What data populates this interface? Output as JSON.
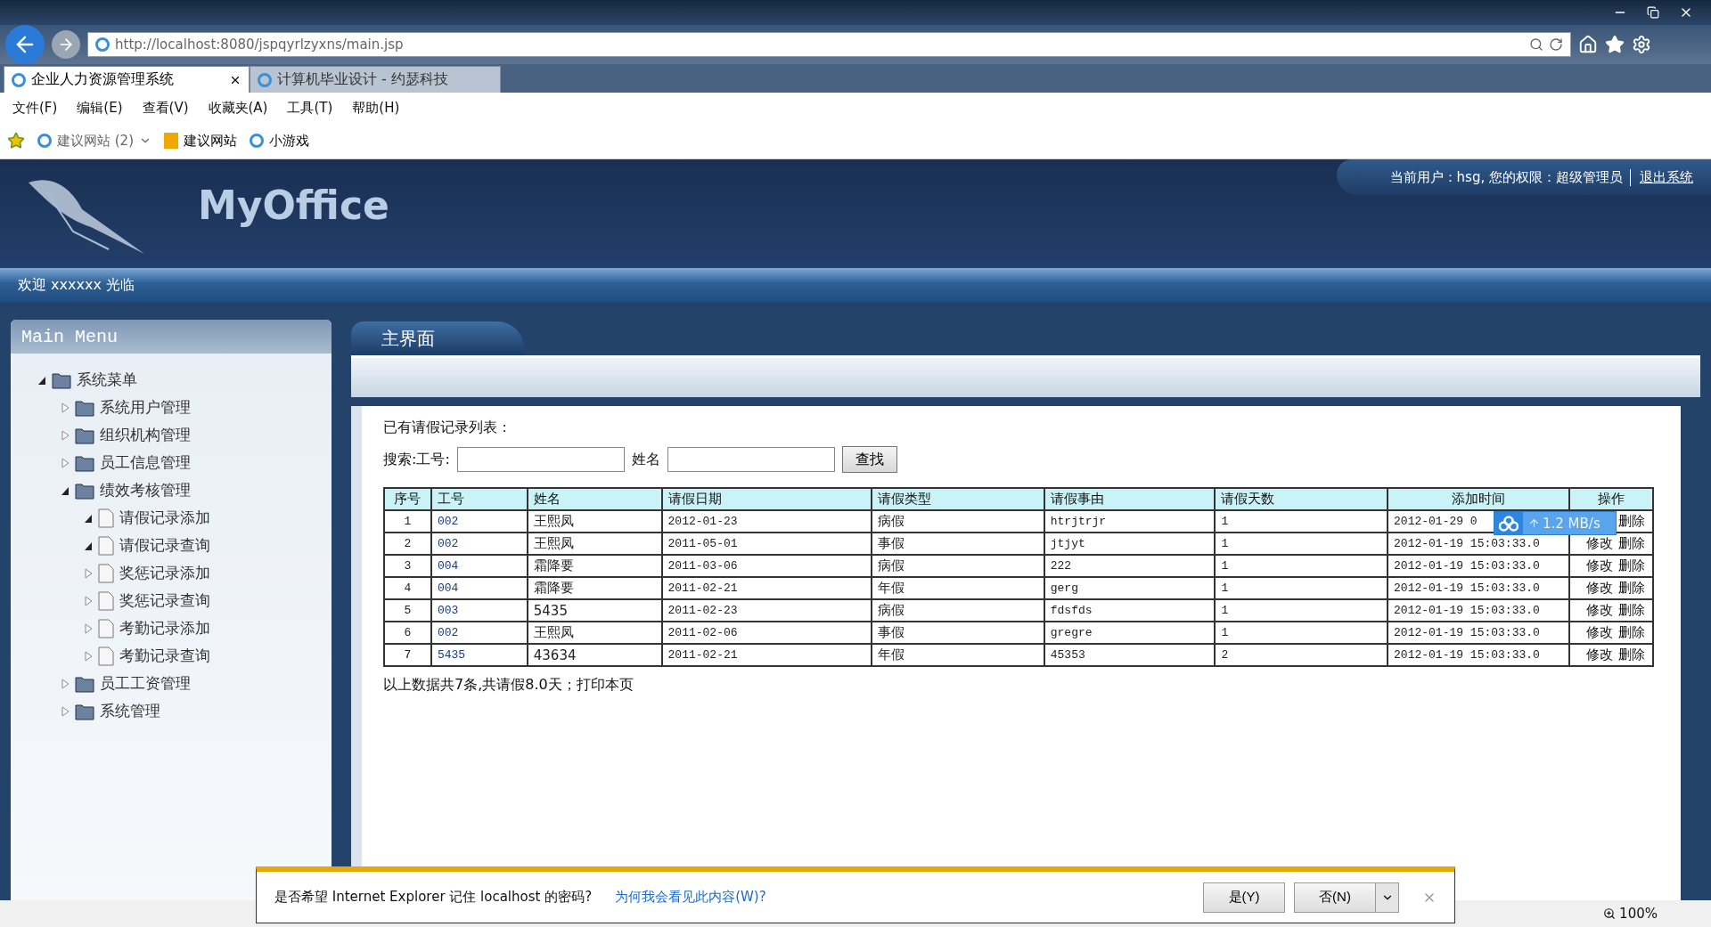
{
  "browser": {
    "address": "http://localhost:8080/jspqyrlzyxns/main.jsp",
    "tabs": [
      {
        "label": "企业人力资源管理系统",
        "selected": true
      },
      {
        "label": "计算机毕业设计 - 约瑟科技",
        "selected": false
      }
    ],
    "menu": [
      "文件(F)",
      "编辑(E)",
      "查看(V)",
      "收藏夹(A)",
      "工具(T)",
      "帮助(H)"
    ],
    "favorites": [
      {
        "label": "建议网站 (2)",
        "kind": "dropdown"
      },
      {
        "label": "建议网站",
        "kind": "bing"
      },
      {
        "label": "小游戏",
        "kind": "page"
      }
    ]
  },
  "header": {
    "logo": "MyOffice",
    "user_info": "当前用户：hsg, 您的权限：超级管理员",
    "logout": "退出系统"
  },
  "welcome": "欢迎 xxxxxx 光临",
  "sidebar": {
    "title": "Main Menu",
    "tree": [
      {
        "label": "系统菜单",
        "kind": "folder",
        "expanded": true,
        "children": [
          {
            "label": "系统用户管理",
            "kind": "folder",
            "expanded": false
          },
          {
            "label": "组织机构管理",
            "kind": "folder",
            "expanded": false
          },
          {
            "label": "员工信息管理",
            "kind": "folder",
            "expanded": false
          },
          {
            "label": "绩效考核管理",
            "kind": "folder",
            "expanded": true,
            "children": [
              {
                "label": "请假记录添加",
                "kind": "page",
                "expanded": true
              },
              {
                "label": "请假记录查询",
                "kind": "page",
                "expanded": true
              },
              {
                "label": "奖惩记录添加",
                "kind": "page",
                "expanded": false
              },
              {
                "label": "奖惩记录查询",
                "kind": "page",
                "expanded": false
              },
              {
                "label": "考勤记录添加",
                "kind": "page",
                "expanded": false
              },
              {
                "label": "考勤记录查询",
                "kind": "page",
                "expanded": false
              }
            ]
          },
          {
            "label": "员工工资管理",
            "kind": "folder",
            "expanded": false
          },
          {
            "label": "系统管理",
            "kind": "folder",
            "expanded": false
          }
        ]
      }
    ]
  },
  "main": {
    "tab": "主界面",
    "list_title": "已有请假记录列表：",
    "search": {
      "id_label": "搜索:工号:",
      "name_label": "姓名",
      "button": "查找"
    },
    "table": {
      "columns": [
        "序号",
        "工号",
        "姓名",
        "请假日期",
        "请假类型",
        "请假事由",
        "请假天数",
        "添加时间",
        "操作"
      ],
      "rows": [
        {
          "cells": [
            "1",
            "002",
            "王熙凤",
            "2012-01-23",
            "病假",
            "htrjtrjr",
            "1",
            "2012-01-29 0"
          ],
          "actions": [
            "删除"
          ]
        },
        {
          "cells": [
            "2",
            "002",
            "王熙凤",
            "2011-05-01",
            "事假",
            "jtjyt",
            "1",
            "2012-01-19 15:03:33.0"
          ],
          "actions": [
            "修改",
            "删除"
          ]
        },
        {
          "cells": [
            "3",
            "004",
            "霜降要",
            "2011-03-06",
            "病假",
            "222",
            "1",
            "2012-01-19 15:03:33.0"
          ],
          "actions": [
            "修改",
            "删除"
          ]
        },
        {
          "cells": [
            "4",
            "004",
            "霜降要",
            "2011-02-21",
            "年假",
            "gerg",
            "1",
            "2012-01-19 15:03:33.0"
          ],
          "actions": [
            "修改",
            "删除"
          ]
        },
        {
          "cells": [
            "5",
            "003",
            "5435",
            "2011-02-23",
            "病假",
            "fdsfds",
            "1",
            "2012-01-19 15:03:33.0"
          ],
          "actions": [
            "修改",
            "删除"
          ]
        },
        {
          "cells": [
            "6",
            "002",
            "王熙凤",
            "2011-02-06",
            "事假",
            "gregre",
            "1",
            "2012-01-19 15:03:33.0"
          ],
          "actions": [
            "修改",
            "删除"
          ]
        },
        {
          "cells": [
            "7",
            "5435",
            "43634",
            "2011-02-21",
            "年假",
            "45353",
            "2",
            "2012-01-19 15:03:33.0"
          ],
          "actions": [
            "修改",
            "删除"
          ]
        }
      ]
    },
    "summary": "以上数据共7条,共请假8.0天；",
    "print_link": "打印本页"
  },
  "speed_widget": "1.2 MB/s",
  "notification": {
    "message": "是否希望 Internet Explorer 记住 localhost 的密码?",
    "link": "为何我会看见此内容(W)?",
    "yes": "是(Y)",
    "no": "否(N)"
  },
  "status": {
    "zoom": "100%"
  }
}
